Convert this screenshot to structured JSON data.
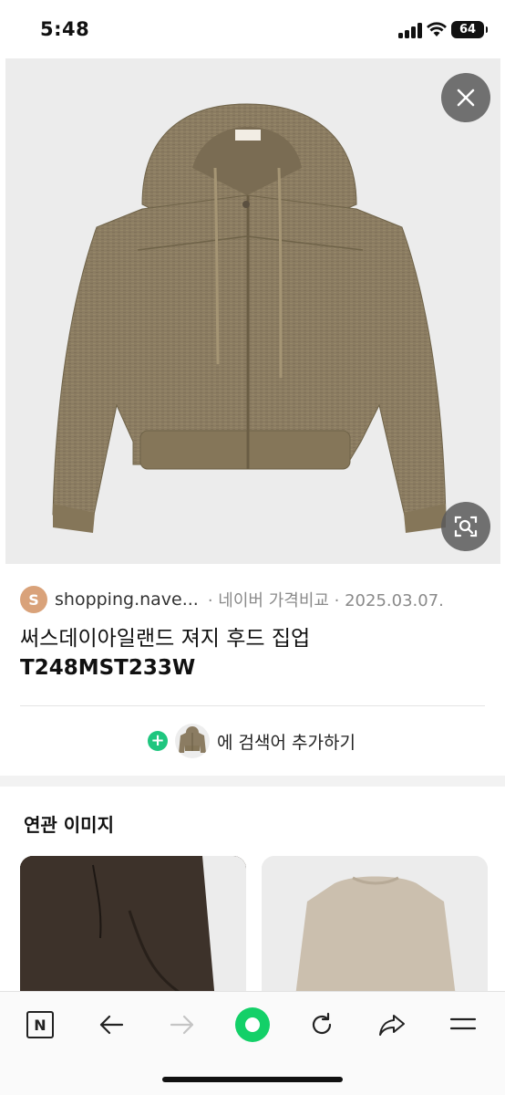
{
  "status_bar": {
    "time": "5:48",
    "battery": "64"
  },
  "viewer": {
    "close_icon": "close-icon",
    "lens_icon": "image-search-icon"
  },
  "source": {
    "avatar_letter": "S",
    "domain": "shopping.nave...",
    "meta": "· 네이버 가격비교 · 2025.03.07."
  },
  "product": {
    "title_kor": "써스데이아일랜드 져지 후드 집업 ",
    "title_code": "T248MST233W"
  },
  "add_search": {
    "label": "에 검색어 추가하기"
  },
  "related": {
    "title": "연관 이미지"
  },
  "bottom_nav": {
    "n_label": "N",
    "items": [
      "naver-n-icon",
      "back-arrow-icon",
      "forward-arrow-icon",
      "green-dot-icon",
      "refresh-icon",
      "share-icon",
      "menu-icon"
    ]
  },
  "colors": {
    "accent_green": "#13d068",
    "hoodie": "#8b7c62",
    "avatar": "#d9a27a"
  }
}
